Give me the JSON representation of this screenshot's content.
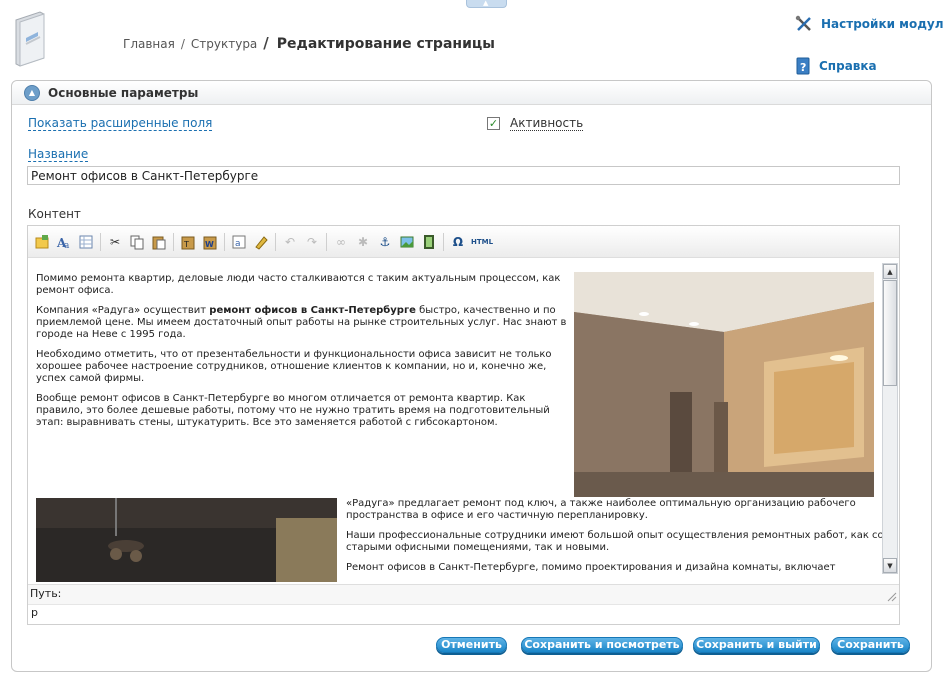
{
  "header": {
    "breadcrumb": {
      "home": "Главная",
      "sep1": "/",
      "structure": "Структура",
      "sep2": "/",
      "current": "Редактирование страницы"
    },
    "links": {
      "settings": "Настройки модуля",
      "help": "Справка"
    }
  },
  "panel": {
    "title": "Основные параметры",
    "show_advanced": "Показать расширенные поля",
    "active_label": "Активность",
    "active_checked": true,
    "name_label": "Название",
    "name_value": "Ремонт офисов в Санкт-Петербурге",
    "content_label": "Контент"
  },
  "editor": {
    "toolbar_icons": [
      "new-page-icon",
      "template-icon",
      "table-icon",
      "cut-icon",
      "copy-icon",
      "paste-icon",
      "paste-text-icon",
      "paste-word-icon",
      "find-replace-icon",
      "clear-format-icon",
      "undo-icon",
      "redo-icon",
      "link-icon",
      "unlink-icon",
      "anchor-icon",
      "image-icon",
      "media-icon",
      "special-char-icon",
      "html-icon"
    ],
    "html_label": "HTML",
    "paragraphs_top": [
      "Помимо ремонта квартир, деловые люди часто сталкиваются с таким актуальным процессом, как ремонт офиса.",
      "Необходимо отметить, что от презентабельности и функциональности офиса зависит не только хорошее рабочее настроение сотрудников, отношение клиентов к компании, но и, конечно же, успех самой фирмы.",
      "Вообще ремонт офисов в Санкт-Петербурге во многом отличается от ремонта квартир. Как правило, это более дешевые работы, потому что не нужно тратить время на подготовительный этап: выравнивать стены, штукатурить. Все это заменяется работой с гибсокартоном."
    ],
    "company_paragraph": {
      "before": "Компания «Радуга» осуществит ",
      "bold": "ремонт офисов в Санкт-Петербурге",
      "after": " быстро, качественно и по приемлемой цене. Мы имеем достаточный опыт работы на рынке строительных услуг. Нас знают в городе на Неве с 1995 года."
    },
    "paragraphs_bottom": [
      "«Радуга» предлагает ремонт под ключ, а также наиболее оптимальную организацию рабочего пространства в офисе и его частичную перепланировку.",
      "Наши профессиональные сотрудники имеют большой опыт осуществления ремонтных работ, как со старыми офисными помещениями, так и новыми.",
      "Ремонт офисов в Санкт-Петербурге, помимо проектирования и дизайна комнаты, включает"
    ],
    "path_label": "Путь:",
    "path_value": "p"
  },
  "buttons": {
    "cancel": "Отменить",
    "save_view": "Сохранить и посмотреть",
    "save_exit": "Сохранить и выйти",
    "save": "Сохранить"
  },
  "colors": {
    "link": "#1a6fb0",
    "button": "#1a86c9"
  }
}
